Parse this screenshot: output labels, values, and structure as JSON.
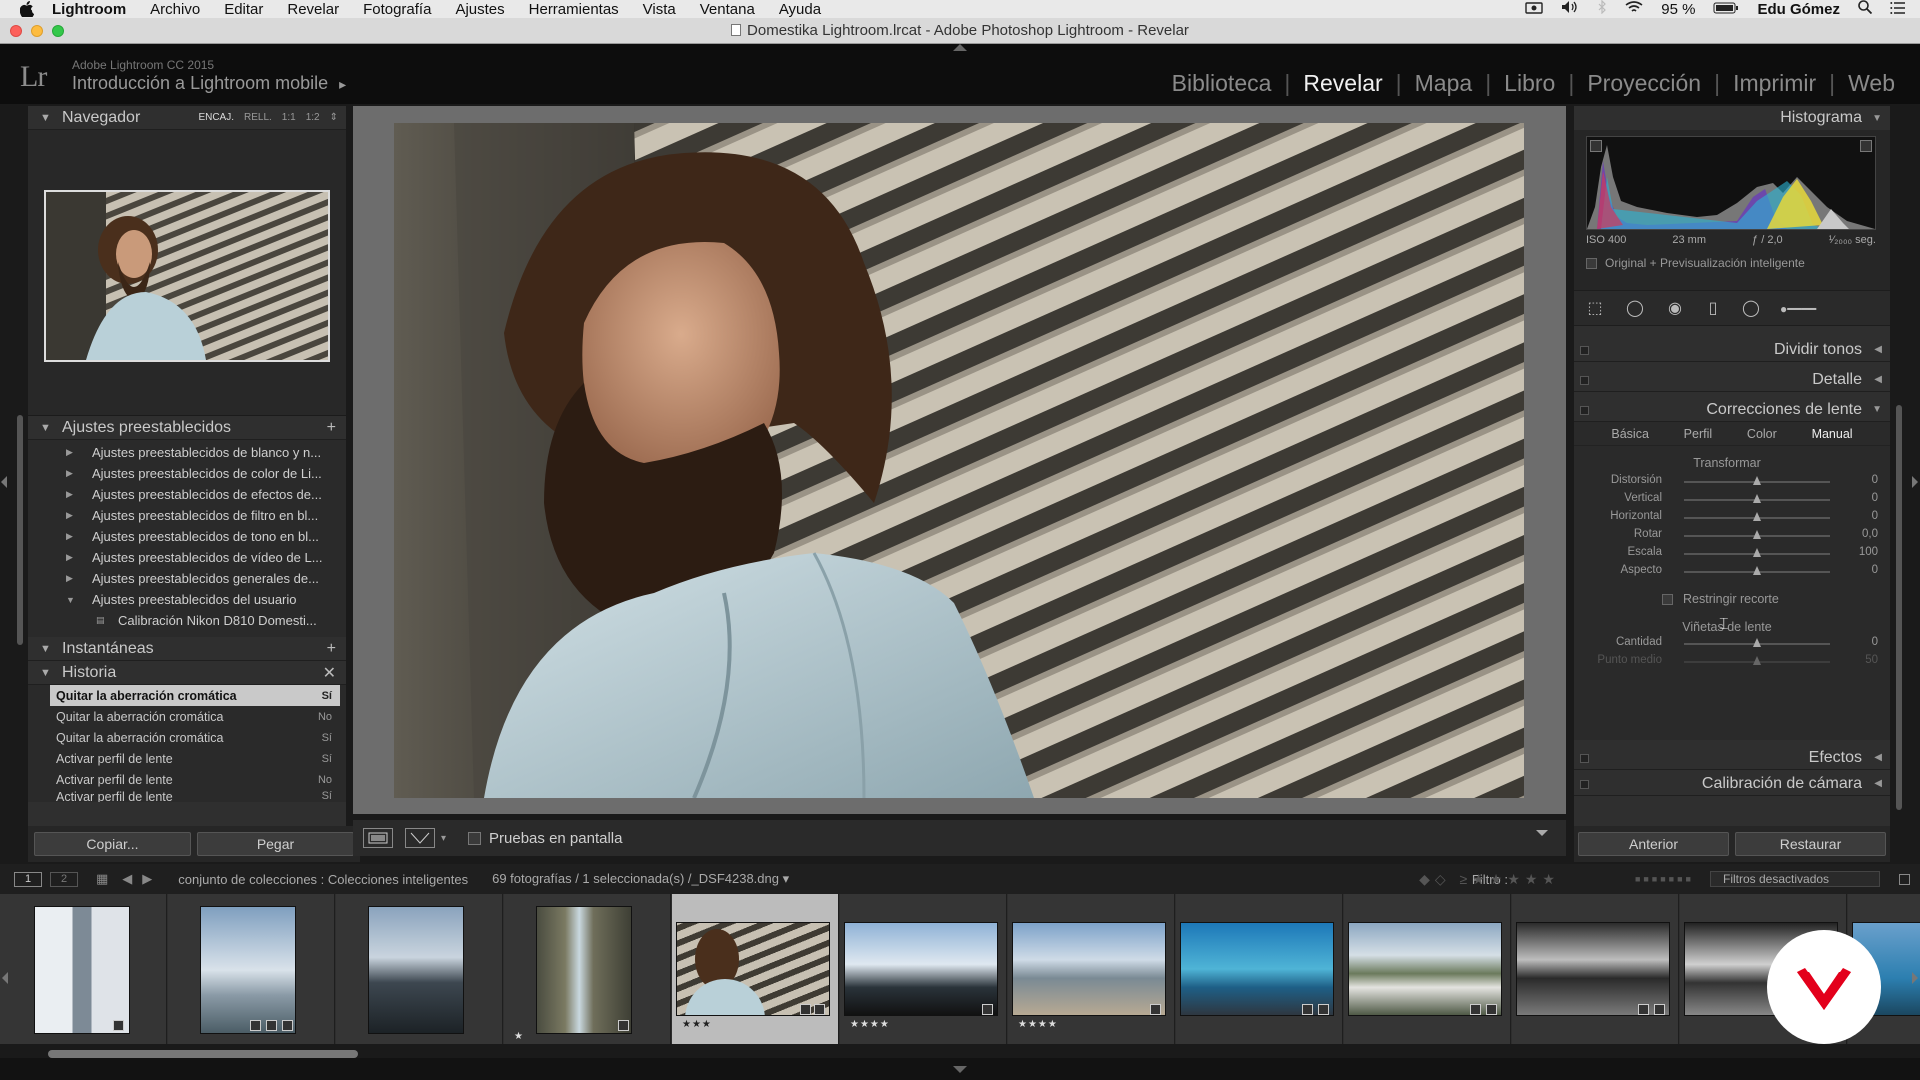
{
  "menubar": {
    "app": "Lightroom",
    "items": [
      "Archivo",
      "Editar",
      "Revelar",
      "Fotografía",
      "Ajustes",
      "Herramientas",
      "Vista",
      "Ventana",
      "Ayuda"
    ],
    "battery": "95 %",
    "user": "Edu Gómez"
  },
  "window": {
    "title": "Domestika Lightroom.lrcat - Adobe Photoshop Lightroom - Revelar"
  },
  "identity": {
    "logo": "Lr",
    "version": "Adobe Lightroom CC 2015",
    "catalog": "Introducción a Lightroom mobile",
    "catalog_arrow": "▸",
    "modules": [
      "Biblioteca",
      "Revelar",
      "Mapa",
      "Libro",
      "Proyección",
      "Imprimir",
      "Web"
    ],
    "active_module": "Revelar"
  },
  "navigator": {
    "title": "Navegador",
    "zoom_options": [
      "ENCAJ.",
      "RELL.",
      "1:1",
      "1:2"
    ],
    "zoom_active": "ENCAJ."
  },
  "presets": {
    "title": "Ajustes preestablecidos",
    "items": [
      "Ajustes preestablecidos de blanco y n...",
      "Ajustes preestablecidos de color de Li...",
      "Ajustes preestablecidos de efectos de...",
      "Ajustes preestablecidos de filtro en bl...",
      "Ajustes preestablecidos de tono en bl...",
      "Ajustes preestablecidos de vídeo de L...",
      "Ajustes preestablecidos generales de...",
      "Ajustes preestablecidos del usuario"
    ],
    "child": "Calibración Nikon D810 Domesti..."
  },
  "snapshots": {
    "title": "Instantáneas"
  },
  "history": {
    "title": "Historia",
    "rows": [
      {
        "label": "Quitar la aberración cromática",
        "value": "Sí"
      },
      {
        "label": "Quitar la aberración cromática",
        "value": "No"
      },
      {
        "label": "Quitar la aberración cromática",
        "value": "Sí"
      },
      {
        "label": "Activar perfil de lente",
        "value": "Sí"
      },
      {
        "label": "Activar perfil de lente",
        "value": "No"
      },
      {
        "label": "Activar perfil de lente",
        "value": "Sí"
      }
    ]
  },
  "left_buttons": {
    "copy": "Copiar...",
    "paste": "Pegar"
  },
  "toolbar": {
    "soft_proof": "Pruebas en pantalla"
  },
  "histogram": {
    "title": "Histograma",
    "iso": "ISO 400",
    "focal": "23 mm",
    "aperture": "ƒ / 2,0",
    "shutter": "¹⁄₂₀₀₀ seg.",
    "preview": "Original + Previsualización inteligente"
  },
  "panels": {
    "split_tone": "Dividir tonos",
    "detail": "Detalle",
    "lens": "Correcciones de lente",
    "effects": "Efectos",
    "calibration": "Calibración de cámara"
  },
  "lens": {
    "tabs": [
      "Básica",
      "Perfil",
      "Color",
      "Manual"
    ],
    "active_tab": "Manual",
    "transform_title": "Transformar",
    "sliders": [
      {
        "label": "Distorsión",
        "value": "0",
        "pos": 0.5
      },
      {
        "label": "Vertical",
        "value": "0",
        "pos": 0.5
      },
      {
        "label": "Horizontal",
        "value": "0",
        "pos": 0.5
      },
      {
        "label": "Rotar",
        "value": "0,0",
        "pos": 0.5
      },
      {
        "label": "Escala",
        "value": "100",
        "pos": 0.5
      },
      {
        "label": "Aspecto",
        "value": "0",
        "pos": 0.5
      }
    ],
    "constrain": "Restringir recorte",
    "vignette_title": "Viñetas de lente",
    "vignette": [
      {
        "label": "Cantidad",
        "value": "0",
        "pos": 0.5
      },
      {
        "label": "Punto medio",
        "value": "50",
        "pos": 0.5
      }
    ]
  },
  "right_buttons": {
    "previous": "Anterior",
    "reset": "Restaurar"
  },
  "filmbar": {
    "page1": "1",
    "page2": "2",
    "source": "conjunto de colecciones : Colecciones inteligentes",
    "count": "69 fotografías / 1 seleccionada(s) /_DSF4238.dng ▾",
    "filter_label": "Filtro :",
    "filters_off": "Filtros desactivados"
  },
  "filmstrip": {
    "ratings": [
      "",
      "",
      "",
      "★",
      "★★★",
      "★★★★",
      "★★★★",
      "",
      "",
      "",
      ""
    ]
  }
}
